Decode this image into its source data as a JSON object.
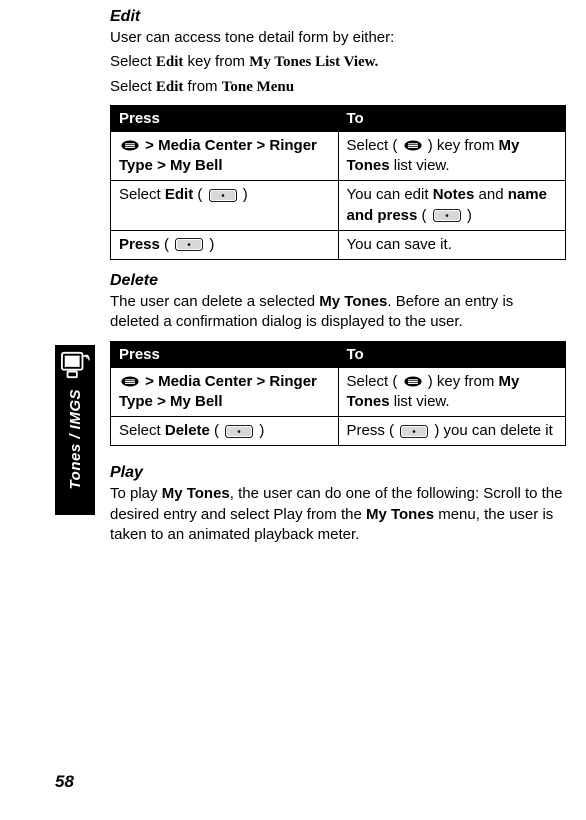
{
  "side": {
    "label": "Tones / IMGS"
  },
  "edit": {
    "title": "Edit",
    "intro": "User can access tone detail form by either:",
    "line2_a": "Select ",
    "line2_b": "Edit",
    "line2_c": " key from ",
    "line2_d": "My Tones List View.",
    "line3_a": "Select ",
    "line3_b": "Edit",
    "line3_c": " from ",
    "line3_d": "Tone Menu",
    "th1": "Press",
    "th2": "To",
    "r1c1_a": " > Media Center > Ringer Type > My Bell",
    "r1c2_a": "Select ( ",
    "r1c2_b": " ) key from ",
    "r1c2_c": "My Tones",
    "r1c2_d": " list view.",
    "r2c1_a": "Select ",
    "r2c1_b": "Edit",
    "r2c1_c": " ( ",
    "r2c1_d": " )",
    "r2c2_a": "You can edit ",
    "r2c2_b": "Notes",
    "r2c2_c": " and ",
    "r2c2_d": "name and press",
    "r2c2_e": " ( ",
    "r2c2_f": " )",
    "r3c1_a": "Press",
    "r3c1_b": " ( ",
    "r3c1_c": " )",
    "r3c2": "You can save it."
  },
  "del": {
    "title": "Delete",
    "p_a": "The user can delete a selected ",
    "p_b": "My Tones",
    "p_c": ". Before an entry is deleted a confirmation dialog is displayed to the user.",
    "th1": "Press",
    "th2": "To",
    "r1c1_a": " > Media Center > Ringer Type > My Bell",
    "r1c2_a": "Select ( ",
    "r1c2_b": " ) key from ",
    "r1c2_c": "My Tones",
    "r1c2_d": " list view.",
    "r2c1_a": "Select ",
    "r2c1_b": "Delete",
    "r2c1_c": " ( ",
    "r2c1_d": " )",
    "r2c2_a": "Press ( ",
    "r2c2_b": " ) you can delete it"
  },
  "play": {
    "title": "Play",
    "p_a": "To play ",
    "p_b": "My Tones",
    "p_c": ", the user can do one of the following: Scroll to the desired entry and select Play from the ",
    "p_d": "My Tones",
    "p_e": " menu, the user is taken to an animated playback meter."
  },
  "page": "58"
}
